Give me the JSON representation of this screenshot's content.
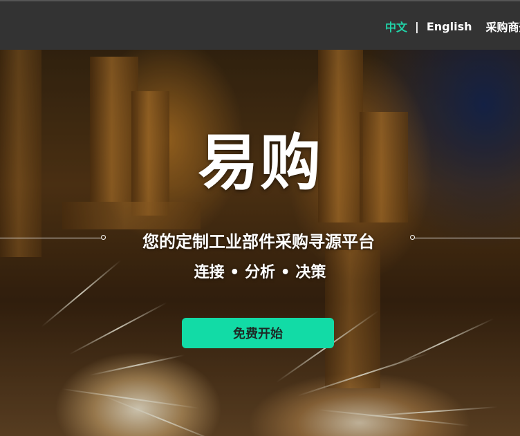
{
  "nav": {
    "lang_cn": "中文",
    "separator": "|",
    "lang_en": "English",
    "supplier_login": "采购商登"
  },
  "hero": {
    "title": "易购",
    "subtitle": "您的定制工业部件采购寻源平台",
    "tagline": "连接 • 分析 • 决策",
    "cta_label": "免费开始"
  },
  "colors": {
    "topbar_bg": "#333333",
    "active_lang": "#21d3a8",
    "cta_bg": "#12dba6"
  }
}
